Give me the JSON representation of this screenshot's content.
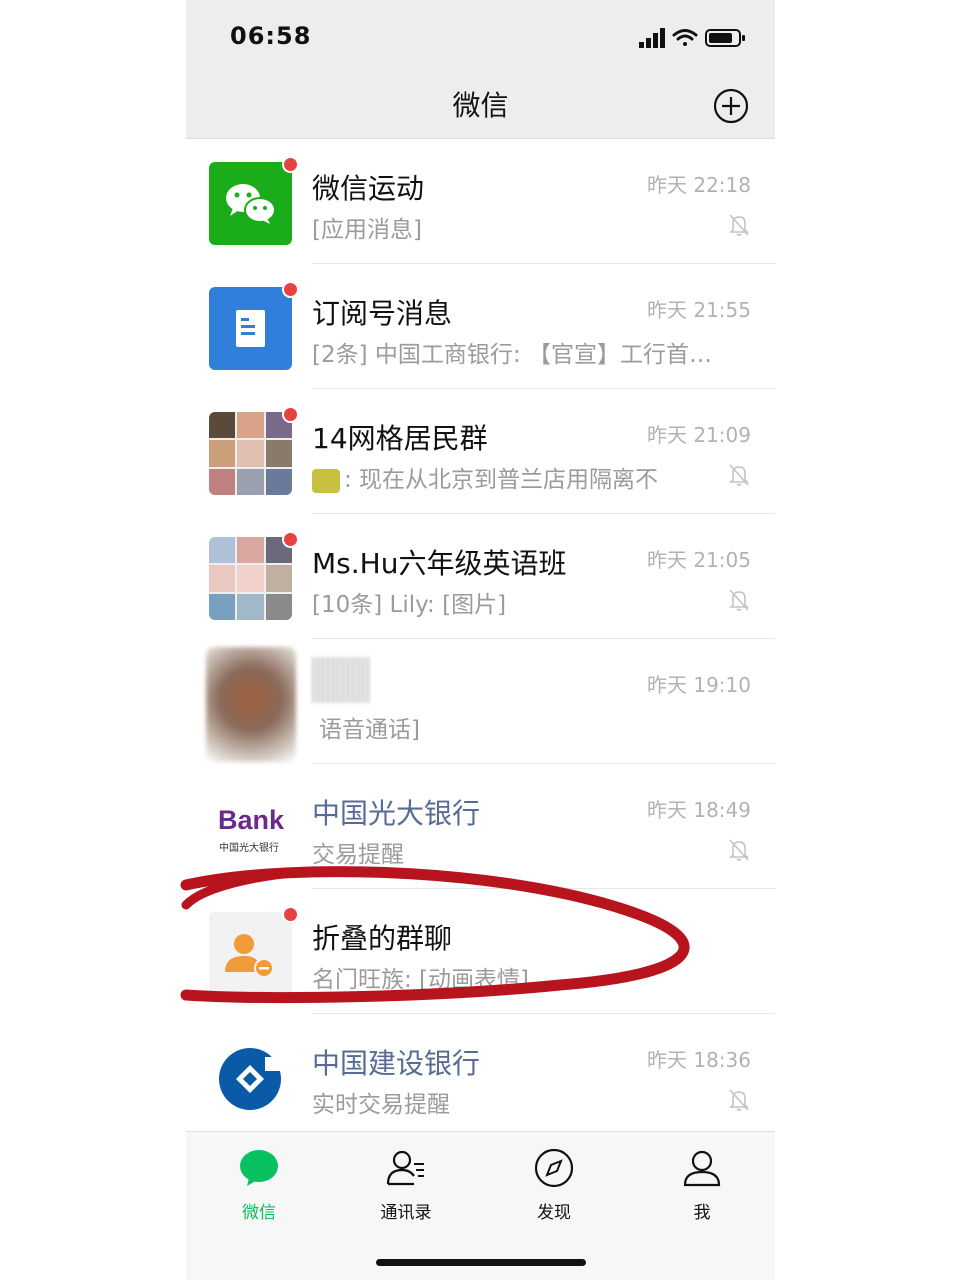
{
  "status_bar": {
    "time": "06:58"
  },
  "header": {
    "title": "微信"
  },
  "chats": [
    {
      "name": "微信运动",
      "preview": "[应用消息]",
      "time": "昨天 22:18",
      "unread": true,
      "muted": true
    },
    {
      "name": "订阅号消息",
      "preview": "[2条] 中国工商银行: 【官宣】工行首…",
      "time": "昨天 21:55",
      "unread": true,
      "muted": false
    },
    {
      "name": "14网格居民群",
      "preview": ": 现在从北京到普兰店用隔离不",
      "time": "昨天 21:09",
      "unread": true,
      "muted": true
    },
    {
      "name": "Ms.Hu六年级英语班",
      "preview": "[10条] Lily: [图片]",
      "time": "昨天 21:05",
      "unread": true,
      "muted": true
    },
    {
      "name": "",
      "preview": "语音通话]",
      "time": "昨天 19:10",
      "unread": false,
      "muted": false
    },
    {
      "name": "中国光大银行",
      "preview": "交易提醒",
      "time": "昨天 18:49",
      "unread": false,
      "muted": true,
      "avatar_text": "Bank",
      "avatar_sub": "中国光大银行"
    },
    {
      "name": "折叠的群聊",
      "preview": "名门旺族: [动画表情]",
      "time": "",
      "unread": true,
      "muted": false
    },
    {
      "name": "中国建设银行",
      "preview": "实时交易提醒",
      "time": "昨天 18:36",
      "unread": false,
      "muted": true
    }
  ],
  "tabs": [
    {
      "label": "微信",
      "icon": "chat-bubble-icon",
      "active": true
    },
    {
      "label": "通讯录",
      "icon": "contacts-icon",
      "active": false
    },
    {
      "label": "发现",
      "icon": "compass-icon",
      "active": false
    },
    {
      "label": "我",
      "icon": "person-icon",
      "active": false
    }
  ],
  "colors": {
    "accent": "#07c160",
    "unread_dot": "#e64340",
    "official_name": "#576b95",
    "annotation_mark": "#b8141e"
  }
}
